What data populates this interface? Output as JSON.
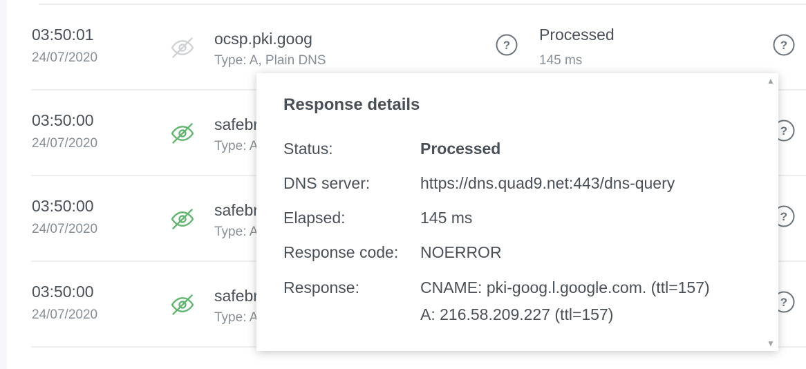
{
  "rows": [
    {
      "time": "03:50:01",
      "date": "24/07/2020",
      "domain": "ocsp.pki.goog",
      "type": "Type: A, Plain DNS",
      "status": "Processed",
      "elapsed": "145 ms",
      "eye_icon": "eye-slash-icon",
      "eye_color": "#d0d3d6"
    },
    {
      "time": "03:50:00",
      "date": "24/07/2020",
      "domain": "safebr",
      "type": "Type: A",
      "eye_icon": "eye-slash-icon",
      "eye_color": "#66b574"
    },
    {
      "time": "03:50:00",
      "date": "24/07/2020",
      "domain": "safebr",
      "type": "Type: A",
      "eye_icon": "eye-slash-icon",
      "eye_color": "#66b574"
    },
    {
      "time": "03:50:00",
      "date": "24/07/2020",
      "domain": "safebr",
      "type": "Type: A",
      "eye_icon": "eye-slash-icon",
      "eye_color": "#66b574"
    }
  ],
  "popover": {
    "title": "Response details",
    "status_label": "Status:",
    "status_value": "Processed",
    "dns_label": "DNS server:",
    "dns_value": "https://dns.quad9.net:443/dns-query",
    "elapsed_label": "Elapsed:",
    "elapsed_value": "145 ms",
    "code_label": "Response code:",
    "code_value": "NOERROR",
    "response_label": "Response:",
    "response_line1": "CNAME: pki-goog.l.google.com. (ttl=157)",
    "response_line2": "A: 216.58.209.227 (ttl=157)"
  },
  "icons": {
    "question": "question-circle-icon",
    "question_color": "#6c757d"
  }
}
